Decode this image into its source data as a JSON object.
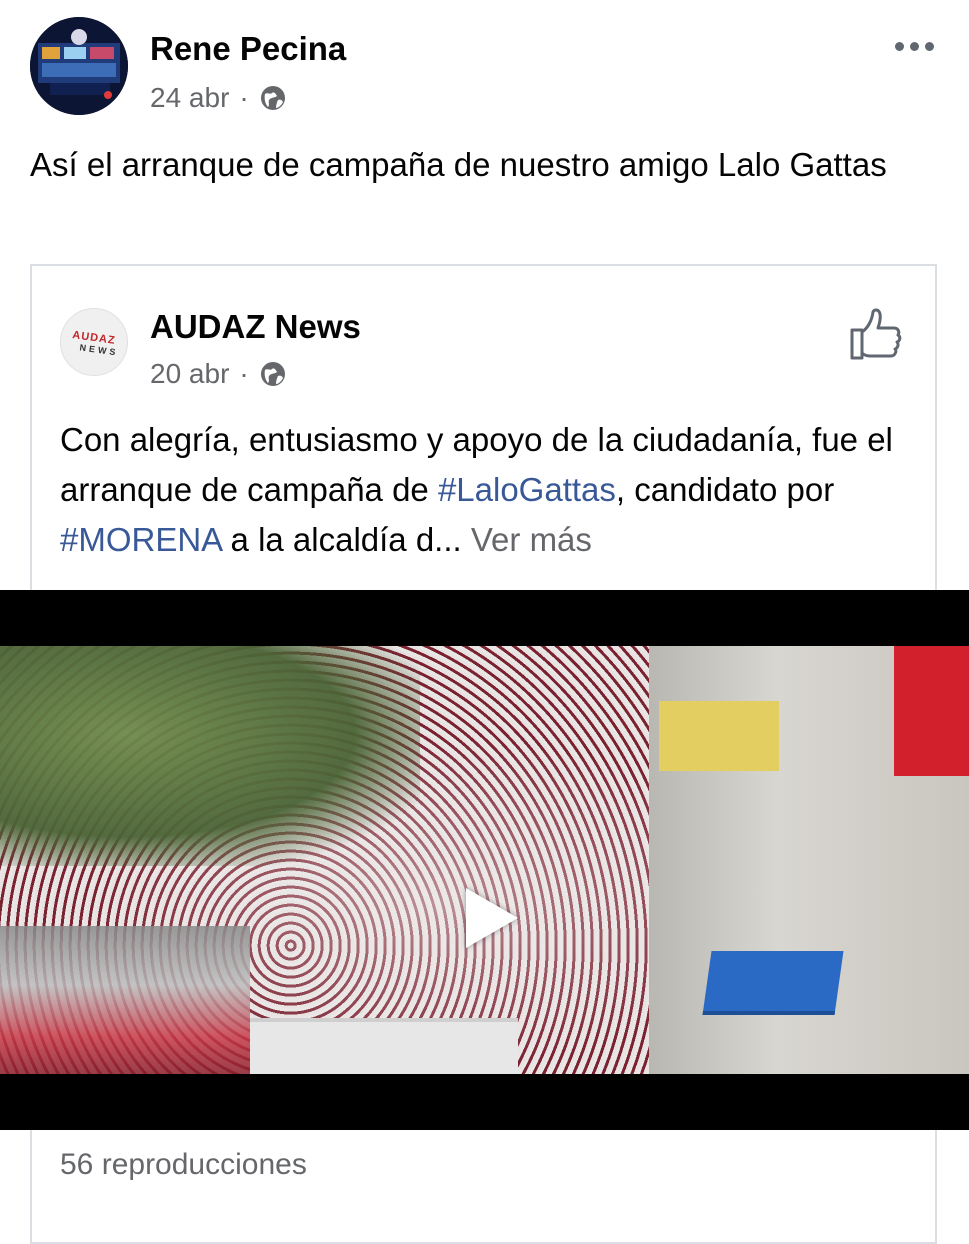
{
  "post": {
    "author": "Rene Pecina",
    "date": "24 abr",
    "separator": "·",
    "privacy_icon": "globe-icon",
    "text": "Así el arranque de campaña de nuestro amigo Lalo Gattas",
    "more_icon": "more-options-icon"
  },
  "shared": {
    "author": "AUDAZ News",
    "avatar_text": "AUDAZ",
    "avatar_subtext": "NEWS",
    "date": "20 abr",
    "separator": "·",
    "privacy_icon": "globe-icon",
    "like_icon": "thumbs-up-icon",
    "text_part1": "Con alegría, entusiasmo y apoyo de la ciudadanía, fue el arranque de campaña de ",
    "hashtag1": "#LaloGattas",
    "text_part2": ", candidato por ",
    "hashtag2": "#MORENA",
    "text_part3": " a la alcaldía d...",
    "see_more": " Ver más",
    "hashtag_color": "#385898"
  },
  "video": {
    "play_icon": "play-icon",
    "views": "56 reproducciones"
  }
}
